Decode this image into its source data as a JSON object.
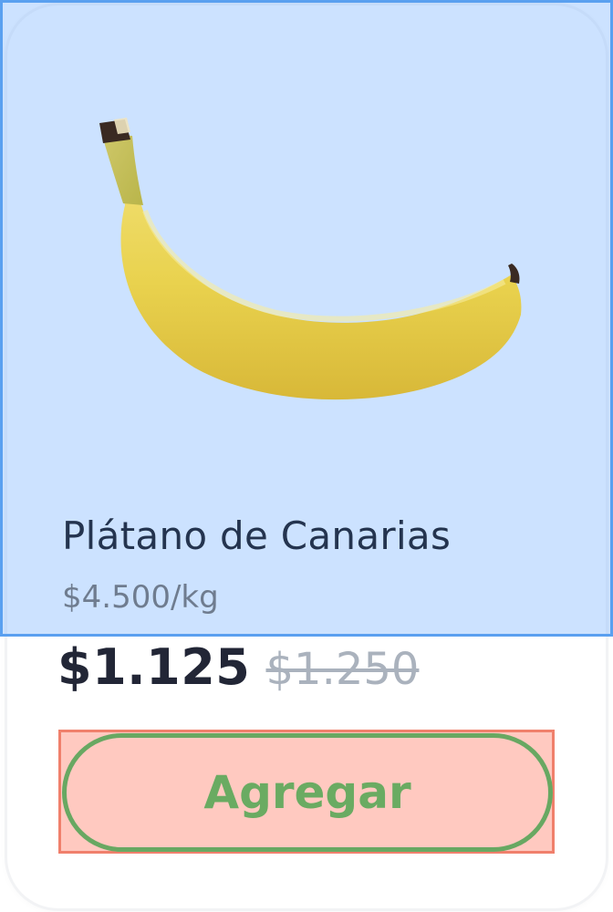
{
  "product": {
    "name": "Plátano de Canarias",
    "price_per_kg": "$4.500/kg",
    "price_now": "$1.125",
    "price_old": "$1.250",
    "image_icon": "banana-image"
  },
  "actions": {
    "add_label": "Agregar"
  },
  "colors": {
    "highlight_blue": "#5aa0f0",
    "highlight_red": "#f0806c",
    "button_green": "#68a862",
    "name_text": "#24344f"
  }
}
